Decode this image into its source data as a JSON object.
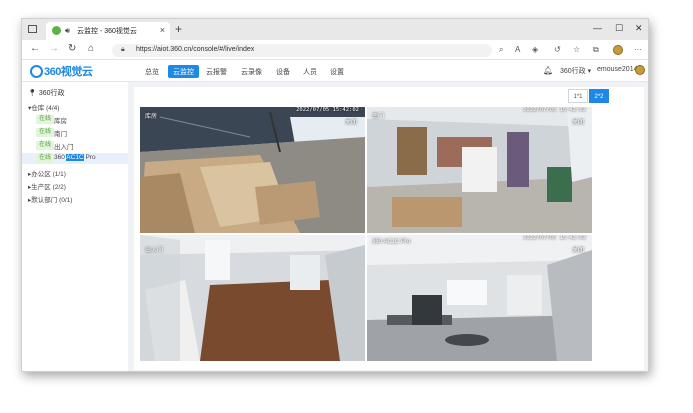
{
  "browser": {
    "tab_title": "云监控 - 360视觉云",
    "url": "https://aiot.360.cn/console/#/live/index",
    "new_tab": "+",
    "tab_close": "×"
  },
  "app": {
    "brand": "360视觉云",
    "menu": [
      "总览",
      "云监控",
      "云报警",
      "云录像",
      "设备",
      "人员",
      "设置"
    ],
    "active_menu": "云监控",
    "org_selector": "360行政 ▾",
    "username": "emouse2014"
  },
  "sidebar": {
    "title": "360行政",
    "groups": [
      {
        "label": "仓库 (4/4)",
        "expanded": true
      },
      {
        "label": "办公区 (1/1)",
        "expanded": false
      },
      {
        "label": "生产区 (2/2)",
        "expanded": false
      },
      {
        "label": "默认部门 (0/1)",
        "expanded": false
      }
    ],
    "cameras": [
      {
        "status": "在线",
        "name": "库房",
        "name_hl": "",
        "name_tail": ""
      },
      {
        "status": "在线",
        "name": "南门",
        "name_hl": "",
        "name_tail": ""
      },
      {
        "status": "在线",
        "name": "出入门",
        "name_hl": "",
        "name_tail": ""
      },
      {
        "status": "在线",
        "name": "360 ",
        "name_hl": "AC1C",
        "name_tail": " Pro"
      }
    ]
  },
  "layout_toggle": {
    "options": [
      "1*1",
      "2*2"
    ],
    "selected": "2*2"
  },
  "feeds": [
    {
      "label": "库房",
      "timestamp": "2022/07/05 15:42:02",
      "close": "关闭"
    },
    {
      "label": "南门",
      "timestamp": "2022/07/05 15:42:02",
      "close": "关闭"
    },
    {
      "label": "出入门",
      "timestamp": "2022/07/05 15:42:02",
      "close": ""
    },
    {
      "label": "360 AC1C Pro",
      "timestamp": "2022/07/05 15:42:02",
      "close": "关闭"
    }
  ]
}
